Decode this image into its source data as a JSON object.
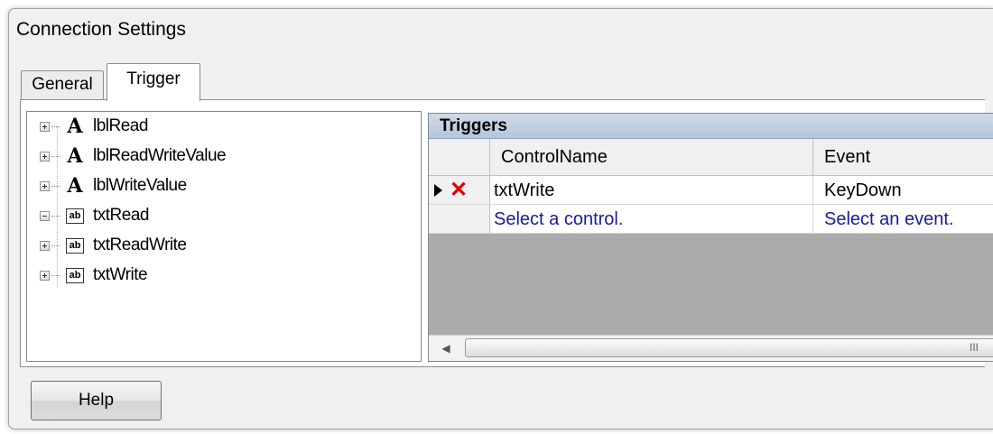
{
  "window": {
    "title": "Connection Settings"
  },
  "tabs": [
    {
      "label": "General",
      "selected": false
    },
    {
      "label": "Trigger",
      "selected": true
    }
  ],
  "tree": {
    "items": [
      {
        "label": "lblRead",
        "icon": "label-A-icon"
      },
      {
        "label": "lblReadWriteValue",
        "icon": "label-A-icon"
      },
      {
        "label": "lblWriteValue",
        "icon": "label-A-icon"
      },
      {
        "label": "txtRead",
        "icon": "textbox-ab-icon"
      },
      {
        "label": "txtReadWrite",
        "icon": "textbox-ab-icon"
      },
      {
        "label": "txtWrite",
        "icon": "textbox-ab-icon"
      }
    ]
  },
  "grid": {
    "caption": "Triggers",
    "columns": [
      "ControlName",
      "Event"
    ],
    "rows": [
      {
        "control": "txtWrite",
        "event": "KeyDown"
      }
    ],
    "new_row": {
      "control": "Select a control.",
      "event": "Select an event."
    },
    "scroll_mark": "III"
  },
  "buttons": {
    "help": "Help"
  },
  "colors": {
    "placeholder": "#1a1aa0",
    "delete": "#e00000",
    "caption_bg": "#c3d2e4"
  }
}
